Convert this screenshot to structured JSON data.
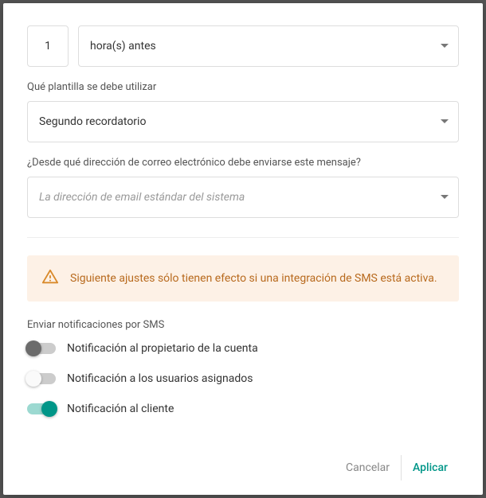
{
  "time": {
    "value": "1",
    "unit": "hora(s) antes"
  },
  "template": {
    "label": "Qué plantilla se debe utilizar",
    "selected": "Segundo recordatorio"
  },
  "from_email": {
    "label": "¿Desde qué dirección de correo electrónico debe enviarse este mensaje?",
    "placeholder": "La dirección de email estándar del sistema"
  },
  "alert": {
    "text": "Siguiente ajustes sólo tienen efecto si una integración de SMS está activa."
  },
  "sms_section": {
    "label": "Enviar notificaciones por SMS",
    "toggles": [
      {
        "label": "Notificación al propietario de la cuenta",
        "on": false,
        "style": "dark"
      },
      {
        "label": "Notificación a los usuarios asignados",
        "on": false,
        "style": "light"
      },
      {
        "label": "Notificación al cliente",
        "on": true,
        "style": "on"
      }
    ]
  },
  "footer": {
    "cancel": "Cancelar",
    "apply": "Aplicar"
  },
  "colors": {
    "accent": "#009688",
    "alert_bg": "#fdf1e6",
    "alert_text": "#b86a1e"
  }
}
